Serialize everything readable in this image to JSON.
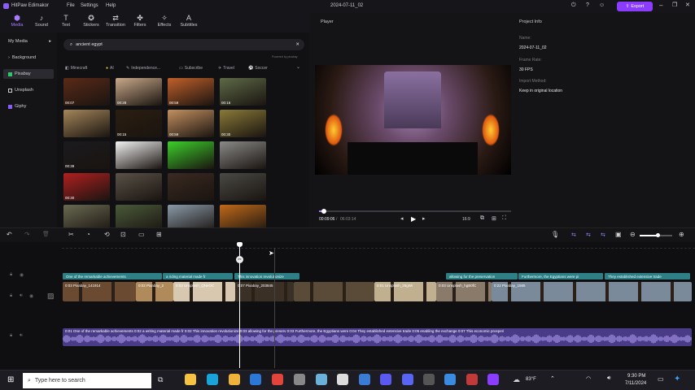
{
  "app": {
    "name": "HitPaw Edimakor",
    "menu": [
      "File",
      "Settings",
      "Help"
    ],
    "doc_title": "2024-07-11_02",
    "export_label": "Export"
  },
  "toolbar": [
    {
      "label": "Media",
      "icon": "media-icon",
      "active": true
    },
    {
      "label": "Sound",
      "icon": "music-note-icon"
    },
    {
      "label": "Text",
      "icon": "text-icon"
    },
    {
      "label": "Stickers",
      "icon": "sticker-icon"
    },
    {
      "label": "Transition",
      "icon": "transition-icon"
    },
    {
      "label": "Filters",
      "icon": "filter-icon"
    },
    {
      "label": "Effects",
      "icon": "effects-icon"
    },
    {
      "label": "Subtitles",
      "icon": "subtitles-icon"
    }
  ],
  "leftnav": [
    {
      "label": "My Media",
      "active": false
    },
    {
      "label": "Background",
      "active": false
    },
    {
      "label": "Pixabay",
      "active": true
    },
    {
      "label": "Unsplash",
      "active": false
    },
    {
      "label": "Giphy",
      "active": false
    }
  ],
  "search": {
    "query": "ancient egypt",
    "powered": "Powered by pixabay"
  },
  "chips": [
    "Minecraft",
    "AI",
    "Independence...",
    "Subscribe",
    "Travel",
    "Soccer"
  ],
  "thumbs": [
    {
      "dur": "00:07",
      "color": "#5a2a18"
    },
    {
      "dur": "00:28",
      "color": "#c9a98a"
    },
    {
      "dur": "00:59",
      "color": "#c0602a"
    },
    {
      "dur": "00:16",
      "color": "#5e6a48"
    },
    {
      "dur": "",
      "color": "#a4865a"
    },
    {
      "dur": "00:15",
      "color": "#2a1e10"
    },
    {
      "dur": "00:59",
      "color": "#c49060"
    },
    {
      "dur": "00:30",
      "color": "#8a7a38"
    },
    {
      "dur": "00:39",
      "color": "#1a1a1e"
    },
    {
      "dur": "",
      "color": "#f2f2f2"
    },
    {
      "dur": "",
      "color": "#3ccf2a"
    },
    {
      "dur": "",
      "color": "#8a8a88"
    },
    {
      "dur": "00:30",
      "color": "#b02020"
    },
    {
      "dur": "",
      "color": "#5a5248"
    },
    {
      "dur": "",
      "color": "#3a2a22"
    },
    {
      "dur": "",
      "color": "#4a4a44"
    },
    {
      "dur": "",
      "color": "#6a6a52"
    },
    {
      "dur": "",
      "color": "#4a5a3a"
    },
    {
      "dur": "",
      "color": "#8a9aa8"
    },
    {
      "dur": "",
      "color": "#c06a1a"
    }
  ],
  "player": {
    "label": "Player",
    "time_current": "00:09:06",
    "time_total": "06:03:14",
    "ratio": "16:9",
    "progress": 0.025
  },
  "info": {
    "title": "Project Info",
    "fields": [
      {
        "label": "Name:",
        "value": "2024-07-11_02"
      },
      {
        "label": "Frame Rate:",
        "value": "30 FPS"
      },
      {
        "label": "Import Method:",
        "value": "Keep in original location"
      }
    ]
  },
  "subtitles": [
    {
      "text": "One of the remarkable achievements"
    },
    {
      "text": "a riding material made fr"
    },
    {
      "text": "This innovation revolutionize"
    },
    {
      "text": "allowing for the preservation"
    },
    {
      "text": "Furthermore, the Egyptians were pi"
    },
    {
      "text": "They established extensive trade"
    }
  ],
  "video_clips": [
    {
      "label": "0:03 Pixabay_141914",
      "color": "#6a4a30"
    },
    {
      "label": "0:02 Pixabay_2",
      "color": "#b08a5a"
    },
    {
      "label": "0:03 Unsplash_QNeOC",
      "color": "#d8c8b0"
    },
    {
      "label": "0:07 Pixabay_203845",
      "color": "#3a3026"
    },
    {
      "label": "",
      "color": "#5a4a38"
    },
    {
      "label": "0:01 Unsplash_25gWi",
      "color": "#c0b090"
    },
    {
      "label": "0:03 Unsplash_hgB0fC",
      "color": "#8a7a6a"
    },
    {
      "label": "0:22 Pixabay_1565",
      "color": "#7a8a9a"
    }
  ],
  "audio": {
    "text": "0:01 One of the remarkable achievements 0:02 a writing material made fr 0:02 This innovation revolutionize 0:03 allowing for the preserv 0:03 Furthermore, the Egyptians were 0:04 They established extensive trade 0:05 enabling the exchange 0:07 This economic prosperi"
  },
  "taskbar": {
    "search_placeholder": "Type here to search",
    "temp": "83°F",
    "time": "9:30 PM",
    "date": "7/11/2024"
  }
}
